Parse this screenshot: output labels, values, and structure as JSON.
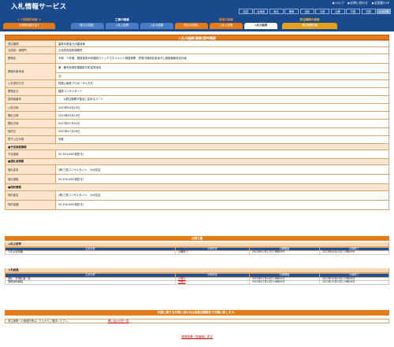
{
  "header": {
    "title": "入札情報サービス",
    "links": [
      "▶ヘルプ",
      "▶お問い合わせ",
      "▶全国版TOP"
    ],
    "regions": [
      "全国",
      "北海道",
      "東北",
      "関東",
      "北陸",
      "中部",
      "近畿",
      "中国",
      "四国",
      "九州沖縄"
    ],
    "selected_region": "九州沖縄"
  },
  "nav": {
    "groups": [
      {
        "title": "★ 中長期的検索 ★",
        "buttons": [
          "中長期情報を探す"
        ]
      },
      {
        "title": "工事の検索",
        "buttons": [
          "発注の見通し",
          "入札公告等",
          "入札の結果"
        ]
      },
      {
        "title": "業務の検索",
        "buttons": [
          "発注の見通し",
          "入札公告等",
          "入札の結果"
        ]
      },
      {
        "title": "発注機関の検索",
        "buttons": [
          "発注機関情報"
        ]
      }
    ]
  },
  "detail": {
    "title": "入札の経緯(業務)案件概要",
    "rows": [
      {
        "label": "発注機関",
        "value": "農林水産省九州農政局"
      },
      {
        "label": "当該部・事務所",
        "value": "土地改良技術事務所"
      },
      {
        "label": "業務名",
        "value": "令和　５年度　国営造成水利施設ストックマネジメント推進事業　肝属中部地区用途ダム施設機能保全計画"
      },
      {
        "label": "業務対象地域",
        "value": "鹿　鹿児島県肝属郡肝付町波見地内",
        "value2": "旦:"
      },
      {
        "label": "入札契約方式",
        "value": "簡易公募型プロポーザル方式"
      },
      {
        "label": "業務区分",
        "value": "建設コンサルタント"
      },
      {
        "label": "技術者番号",
        "value": "　　※発注機関が独自に定めるコード"
      },
      {
        "label": "公告日時",
        "value": "2023年04月19日"
      },
      {
        "label": "開札日時",
        "value": "2023年05月10日"
      },
      {
        "label": "開札日時",
        "value": "2023年07月03日"
      },
      {
        "label": "契約日",
        "value": "2023年07月18日"
      },
      {
        "label": "電子入札対象",
        "value": "対象"
      }
    ],
    "budget_section": "■予定価格情報",
    "budget_label": "予定価格",
    "budget_value": "54,320,000(税抜き)",
    "winner_section": "■落札者情報",
    "winner_rows": [
      {
        "label": "落札者名",
        "value": "(株)三祐コンサルタンツ　九州支店"
      },
      {
        "label": "落札価格",
        "value": "54,300,000(税抜き)"
      }
    ],
    "contract_section": "■契約情報",
    "contract_rows": [
      {
        "label": "契約者名",
        "value": "(株)三祐コンサルタンツ　九州支店"
      },
      {
        "label": "契約金額",
        "value": "54,300,000(税抜き)"
      }
    ]
  },
  "docs": {
    "title": "公開文書",
    "group1": {
      "title": "入札公告等",
      "headers": [
        "文書名称",
        "公開状況",
        "公開開始",
        "公開終了"
      ],
      "rows": [
        [
          "入札公告情報",
          "公開終了",
          "2023年07月17日 16時00分",
          "2023年05月10日 23時59分"
        ]
      ]
    },
    "group2": {
      "title": "入札経過",
      "headers": [
        "文書名称",
        "公開状況",
        "公開開始",
        "公開終了"
      ],
      "rows": [
        [
          "落札・非落札者一覧",
          "公開中",
          "2023年07月18日 16時00分",
          "2023年10月18日 23時59分"
        ],
        [
          "業務契約締結",
          "公開中",
          "2023年07月18日 16時00分",
          "2023年10月18日 23時59分"
        ]
      ]
    }
  },
  "contact": {
    "bar": "内容に関するお問い合わせは各発注機関までお願い致します。",
    "text": "発注機関への連絡先等はこちらからご確認ください。",
    "link": "問い合わせ先一覧"
  },
  "back_link": "検索結果一覧画面に戻る",
  "colors": {
    "header": "#1a4a8c",
    "accent": "#e47a18",
    "label_bg": "#fde6cf"
  }
}
